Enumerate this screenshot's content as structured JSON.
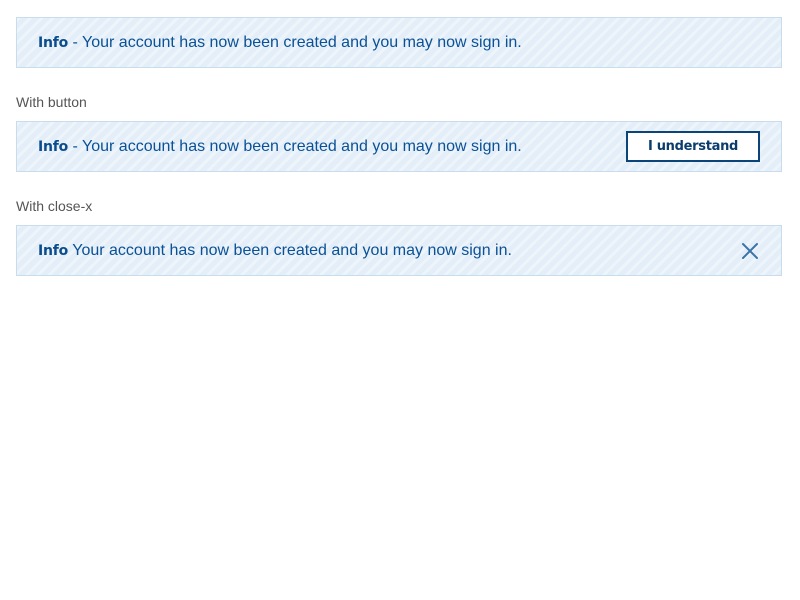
{
  "notices": [
    {
      "strong": "Info",
      "separator": " - ",
      "message": "Your account has now been created and you may now sign in."
    },
    {
      "strong": "Info",
      "separator": " - ",
      "message": "Your account has now been created and you may now sign in.",
      "button_label": "I understand"
    },
    {
      "strong": "Info",
      "separator": " ",
      "message": "Your account has now been created and you may now sign in.",
      "close_icon": "close-icon"
    }
  ],
  "labels": {
    "with_button": "With button",
    "with_close": "With close-x"
  },
  "colors": {
    "notice_background": "#e4eef8",
    "notice_border": "#c9dced",
    "notice_text": "#0a5196",
    "button_border": "#0b4478"
  }
}
